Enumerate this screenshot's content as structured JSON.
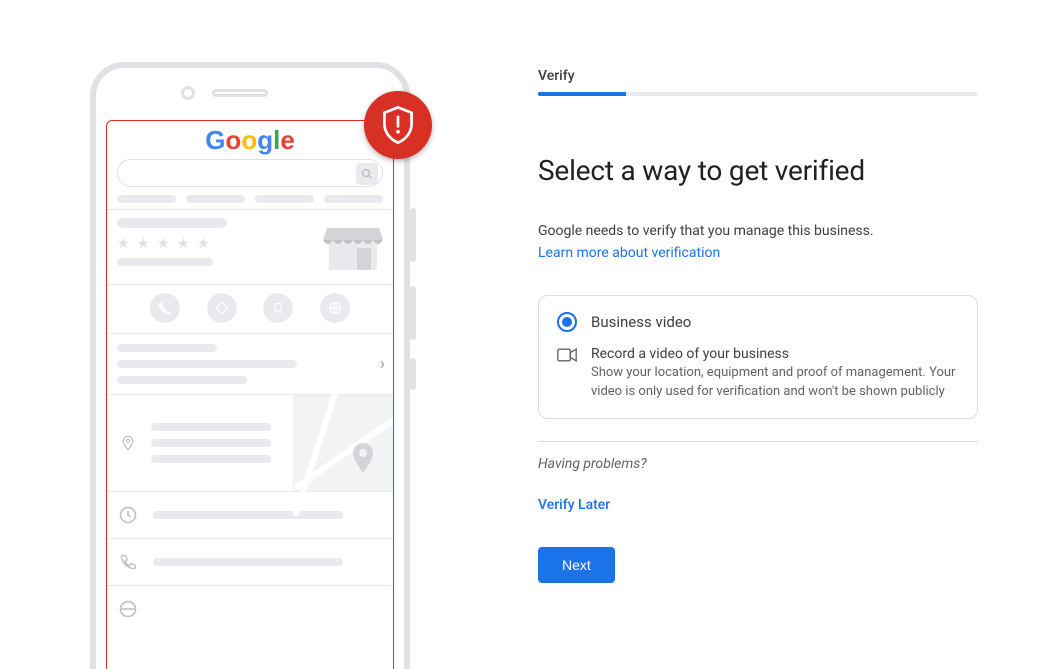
{
  "step_label": "Verify",
  "progress_pct": 20,
  "headline": "Select a way to get verified",
  "subtext": "Google needs to verify that you manage this business.",
  "learn_more": "Learn more about verification",
  "option": {
    "label": "Business video",
    "detail_title": "Record a video of your business",
    "detail_desc": "Show your location, equipment and proof of management. Your video is only used for verification and won't be shown publicly"
  },
  "having_problems": "Having problems?",
  "verify_later": "Verify Later",
  "next": "Next",
  "logo_letters": [
    "G",
    "o",
    "o",
    "g",
    "l",
    "e"
  ]
}
